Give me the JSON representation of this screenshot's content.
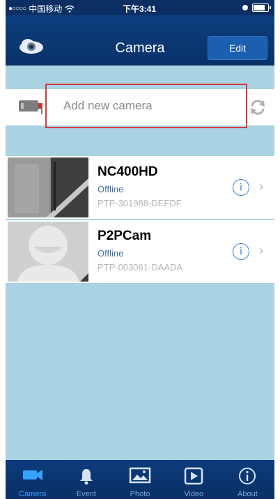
{
  "status_bar": {
    "carrier": "中国移动",
    "time": "下午3:41"
  },
  "nav": {
    "title": "Camera",
    "edit_label": "Edit"
  },
  "add_camera": {
    "placeholder": "Add new camera"
  },
  "cameras": [
    {
      "name": "NC400HD",
      "status": "Offline",
      "id": "PTP-301988-DEFDF"
    },
    {
      "name": "P2PCam",
      "status": "Offline",
      "id": "PTP-003061-DAADA"
    }
  ],
  "tabs": [
    {
      "label": "Camera",
      "icon": "video-camera-icon",
      "active": true
    },
    {
      "label": "Event",
      "icon": "bell-icon",
      "active": false
    },
    {
      "label": "Photo",
      "icon": "photo-icon",
      "active": false
    },
    {
      "label": "Video",
      "icon": "play-icon",
      "active": false
    },
    {
      "label": "About",
      "icon": "info-icon",
      "active": false
    }
  ],
  "colors": {
    "nav_bar": "#0b3670",
    "background": "#a9d3e3",
    "status_text": "#3f6fa8",
    "highlight_box": "#d63b3b",
    "active_tab": "#38a3ff"
  }
}
